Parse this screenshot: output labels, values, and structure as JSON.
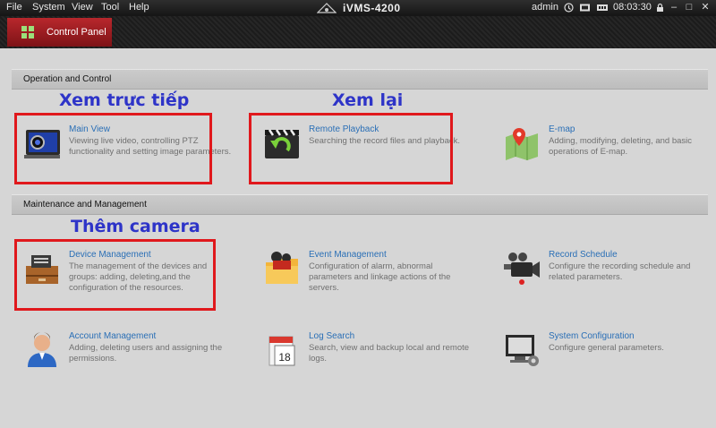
{
  "menubar": {
    "items": [
      "File",
      "System",
      "View",
      "Tool",
      "Help"
    ],
    "app_title": "iVMS-4200",
    "user": "admin",
    "time": "08:03:30"
  },
  "tab": {
    "label": "Control Panel"
  },
  "sections": {
    "operation": "Operation and Control",
    "maintenance": "Maintenance and Management"
  },
  "modules": {
    "main_view": {
      "title": "Main View",
      "desc": "Viewing live video, controlling PTZ functionality and setting image parameters."
    },
    "remote_playback": {
      "title": "Remote Playback",
      "desc": "Searching the record files and playback."
    },
    "emap": {
      "title": "E-map",
      "desc": "Adding, modifying, deleting, and basic operations of E-map."
    },
    "device_management": {
      "title": "Device Management",
      "desc": "The management of the devices and groups: adding, deleting,and the configuration of the resources."
    },
    "event_management": {
      "title": "Event Management",
      "desc": "Configuration of alarm, abnormal parameters and linkage actions of the servers."
    },
    "record_schedule": {
      "title": "Record Schedule",
      "desc": "Configure the recording schedule and related parameters."
    },
    "account_management": {
      "title": "Account Management",
      "desc": "Adding, deleting users and assigning the permissions."
    },
    "log_search": {
      "title": "Log Search",
      "desc": "Search, view and backup local and remote logs."
    },
    "system_configuration": {
      "title": "System Configuration",
      "desc": "Configure general parameters."
    }
  },
  "annotations": {
    "live_view": "Xem trực tiếp",
    "playback": "Xem lại",
    "add_camera": "Thêm camera"
  },
  "colors": {
    "annotation_box": "#e0181c",
    "annotation_text": "#2e34c8",
    "module_title": "#2a6fb6",
    "tab_active": "#b8272c"
  },
  "icons": {
    "tab": "grid-icon",
    "main_view": "monitor-icon",
    "remote_playback": "clapperboard-playback-icon",
    "emap": "map-pin-icon",
    "device_management": "device-drawer-icon",
    "event_management": "folder-camera-icon",
    "record_schedule": "video-camera-icon",
    "account_management": "user-icon",
    "log_search": "calendar-log-icon",
    "system_configuration": "computer-gear-icon"
  }
}
